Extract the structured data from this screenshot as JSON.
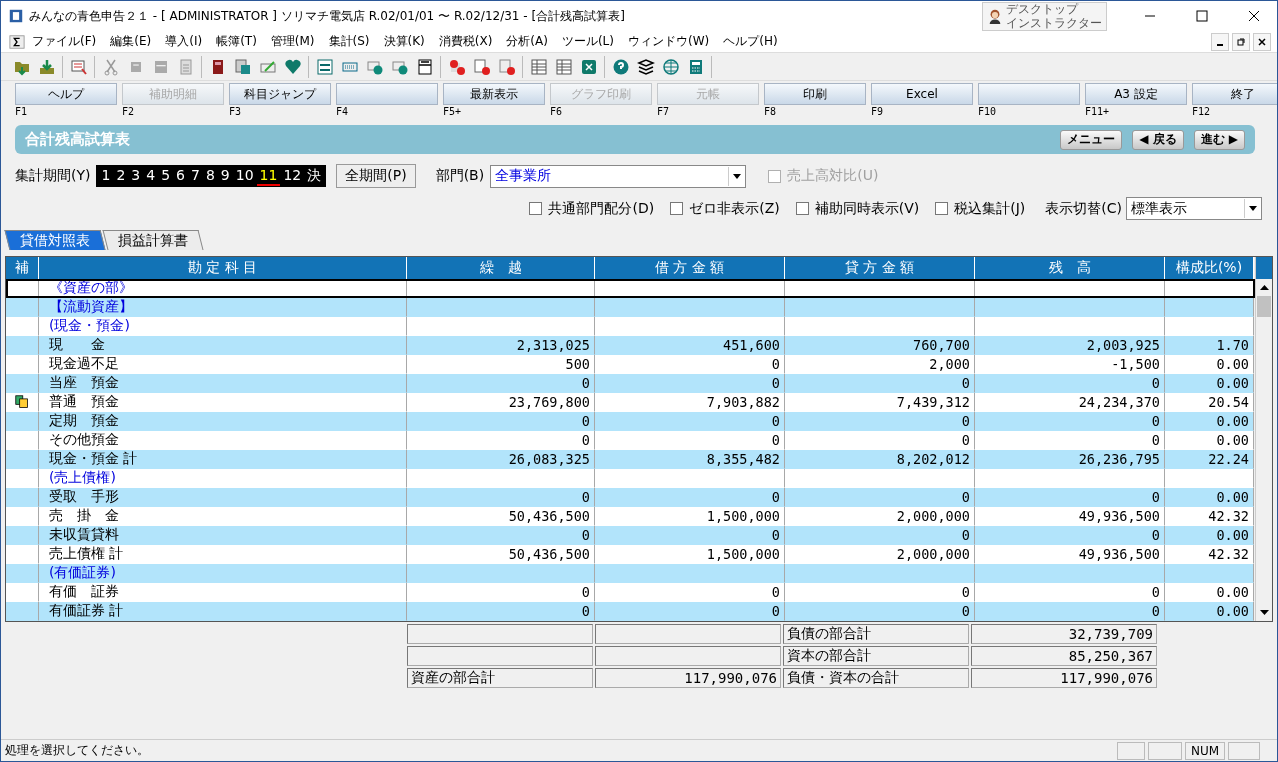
{
  "window": {
    "title": "みんなの青色申告２１ - [ ADMINISTRATOR ] ソリマチ電気店 R.02/01/01 〜 R.02/12/31 - [合計残高試算表]",
    "badge": [
      "デスクトップ",
      "インストラクター"
    ]
  },
  "menu": [
    "ファイル(F)",
    "編集(E)",
    "導入(I)",
    "帳簿(T)",
    "管理(M)",
    "集計(S)",
    "決算(K)",
    "消費税(X)",
    "分析(A)",
    "ツール(L)",
    "ウィンドウ(W)",
    "ヘルプ(H)"
  ],
  "function_keys": [
    {
      "label": "ヘルプ",
      "key": "F1",
      "disabled": false
    },
    {
      "label": "補助明細",
      "key": "F2",
      "disabled": true
    },
    {
      "label": "科目ジャンプ",
      "key": "F3",
      "disabled": false
    },
    {
      "key": "F4",
      "disabled": false
    },
    {
      "label": "最新表示",
      "key": "F5+",
      "disabled": false
    },
    {
      "label": "グラフ印刷",
      "key": "F6",
      "disabled": true
    },
    {
      "label": "元帳",
      "key": "F7",
      "disabled": true
    },
    {
      "label": "印刷",
      "key": "F8",
      "disabled": false
    },
    {
      "label": "Excel",
      "key": "F9",
      "disabled": false
    },
    {
      "key": "F10",
      "disabled": false
    },
    {
      "label": "A3 設定",
      "key": "F11+",
      "disabled": false
    },
    {
      "label": "終了",
      "key": "F12",
      "disabled": false
    }
  ],
  "header": {
    "title": "合計残高試算表",
    "nav": [
      "メニュー",
      "◀ 戻る",
      "進む ▶"
    ]
  },
  "period": {
    "label": "集計期間(Y)",
    "periods": [
      {
        "label": "1",
        "selected": false
      },
      {
        "label": "2",
        "selected": false
      },
      {
        "label": "3",
        "selected": false
      },
      {
        "label": "4",
        "selected": false
      },
      {
        "label": "5",
        "selected": false
      },
      {
        "label": "6",
        "selected": false
      },
      {
        "label": "7",
        "selected": false
      },
      {
        "label": "8",
        "selected": false
      },
      {
        "label": "9",
        "selected": false
      },
      {
        "label": "10",
        "selected": false
      },
      {
        "label": "11",
        "selected": true
      },
      {
        "label": "12",
        "selected": false
      },
      {
        "label": "決",
        "selected": false
      }
    ],
    "all_button": "全期間(P)"
  },
  "department": {
    "label": "部門(B)",
    "value": "全事業所"
  },
  "sales_ratio": {
    "label": "売上高対比(U)",
    "checked": false,
    "disabled": true
  },
  "options": [
    {
      "label": "共通部門配分(D)",
      "checked": false
    },
    {
      "label": "ゼロ非表示(Z)",
      "checked": false
    },
    {
      "label": "補助同時表示(V)",
      "checked": false
    },
    {
      "label": "税込集計(J)",
      "checked": false
    }
  ],
  "display": {
    "label": "表示切替(C)",
    "value": "標準表示"
  },
  "tabs": [
    {
      "label": "貸借対照表",
      "selected": true
    },
    {
      "label": "損益計算書",
      "selected": false
    }
  ],
  "table": {
    "columns": [
      "補",
      "勘 定 科 目",
      "繰　越",
      "借 方 金 額",
      "貸 方 金 額",
      "残　高",
      "構成比(%)"
    ],
    "rows": [
      {
        "kind": "heading",
        "name": "《資産の部》",
        "focused": true
      },
      {
        "kind": "heading",
        "name": "【流動資産】",
        "focused": false
      },
      {
        "kind": "heading",
        "name": "(現金・預金)",
        "focused": false
      },
      {
        "kind": "account",
        "name": "現　　金",
        "values": [
          "2,313,025",
          "451,600",
          "760,700",
          "2,003,925",
          "1.70"
        ],
        "focused": false
      },
      {
        "kind": "account",
        "name": "現金過不足",
        "values": [
          "500",
          "0",
          "2,000",
          "-1,500",
          "0.00"
        ],
        "focused": false
      },
      {
        "kind": "account",
        "name": "当座　預金",
        "values": [
          "0",
          "0",
          "0",
          "0",
          "0.00"
        ],
        "focused": false
      },
      {
        "kind": "account",
        "name": "普通　預金",
        "values": [
          "23,769,800",
          "7,903,882",
          "7,439,312",
          "24,234,370",
          "20.54"
        ],
        "focused": false,
        "sub": true
      },
      {
        "kind": "account",
        "name": "定期　預金",
        "values": [
          "0",
          "0",
          "0",
          "0",
          "0.00"
        ],
        "focused": false
      },
      {
        "kind": "account",
        "name": "その他預金",
        "values": [
          "0",
          "0",
          "0",
          "0",
          "0.00"
        ],
        "focused": false
      },
      {
        "kind": "account",
        "name": "現金・預金 計",
        "values": [
          "26,083,325",
          "8,355,482",
          "8,202,012",
          "26,236,795",
          "22.24"
        ],
        "focused": false
      },
      {
        "kind": "heading",
        "name": "(売上債権)",
        "focused": false
      },
      {
        "kind": "account",
        "name": "受取　手形",
        "values": [
          "0",
          "0",
          "0",
          "0",
          "0.00"
        ],
        "focused": false
      },
      {
        "kind": "account",
        "name": "売　掛　金",
        "values": [
          "50,436,500",
          "1,500,000",
          "2,000,000",
          "49,936,500",
          "42.32"
        ],
        "focused": false
      },
      {
        "kind": "account",
        "name": "未収賃貸料",
        "values": [
          "0",
          "0",
          "0",
          "0",
          "0.00"
        ],
        "focused": false
      },
      {
        "kind": "account",
        "name": "売上債権 計",
        "values": [
          "50,436,500",
          "1,500,000",
          "2,000,000",
          "49,936,500",
          "42.32"
        ],
        "focused": false
      },
      {
        "kind": "heading",
        "name": "(有価証券)",
        "focused": false
      },
      {
        "kind": "account",
        "name": "有価　証券",
        "values": [
          "0",
          "0",
          "0",
          "0",
          "0.00"
        ],
        "focused": false
      },
      {
        "kind": "account",
        "name": "有価証券 計",
        "values": [
          "0",
          "0",
          "0",
          "0",
          "0.00"
        ],
        "focused": false
      }
    ]
  },
  "totals": [
    {
      "right_label": "負債の部合計",
      "right_amount": "32,739,709"
    },
    {
      "right_label": "資本の部合計",
      "right_amount": "85,250,367"
    },
    {
      "left_label": "資産の部合計",
      "left_amount": "117,990,076",
      "right_label": "負債・資本の合計",
      "right_amount": "117,990,076"
    }
  ],
  "status_bar": {
    "message": "処理を選択してください。",
    "indicator": "NUM"
  }
}
